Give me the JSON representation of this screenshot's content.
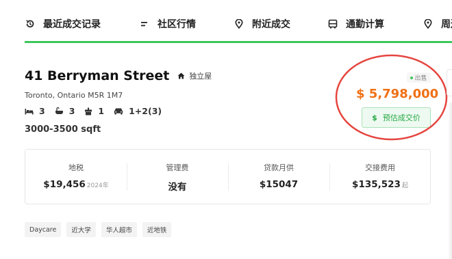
{
  "nav": {
    "items": [
      {
        "label": "最近成交记录",
        "icon": "history-icon"
      },
      {
        "label": "社区行情",
        "icon": "list-lines-icon"
      },
      {
        "label": "附近成交",
        "icon": "map-pin-icon"
      },
      {
        "label": "通勤计算",
        "icon": "bus-icon"
      },
      {
        "label": "周边",
        "icon": "map-pin-icon"
      }
    ],
    "accent_color": "#3cc75b"
  },
  "listing": {
    "street": "41 Berryman Street",
    "house_type": "独立屋",
    "address": "Toronto, Ontario M5R 1M7",
    "bedrooms": "3",
    "bathrooms": "3",
    "kitchens": "1",
    "parking": "1+2(3)",
    "sqft": "3000-3500 sqft",
    "status": "出售",
    "price": "$ 5,798,000",
    "price_color": "#f07014",
    "estimate_button": "预估成交价",
    "estimate_button_icon": "$"
  },
  "costs": [
    {
      "label": "地税",
      "value": "$19,456",
      "sub": "2024年"
    },
    {
      "label": "管理费",
      "value": "没有",
      "sub": ""
    },
    {
      "label": "贷款月供",
      "value": "$15047",
      "sub": ""
    },
    {
      "label": "交接费用",
      "value": "$135,523",
      "sub": "起"
    }
  ],
  "tags": [
    "Daycare",
    "近大学",
    "华人超市",
    "近地铁"
  ]
}
